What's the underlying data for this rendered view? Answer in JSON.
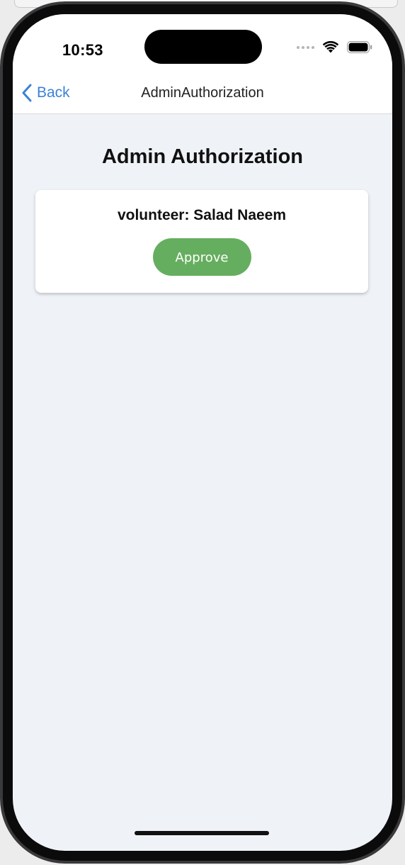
{
  "status_bar": {
    "time": "10:53",
    "icons": [
      "signal-dots-icon",
      "wifi-icon",
      "battery-icon"
    ]
  },
  "nav": {
    "back_label": "Back",
    "title": "AdminAuthorization",
    "accent_color": "#3b82d6"
  },
  "main": {
    "title": "Admin Authorization",
    "requests": [
      {
        "name": "volunteer: Salad Naeem",
        "approve_label": "Approve",
        "approve_color": "#66ae5f"
      }
    ]
  },
  "colors": {
    "background": "#eff2f7",
    "card": "#ffffff"
  }
}
